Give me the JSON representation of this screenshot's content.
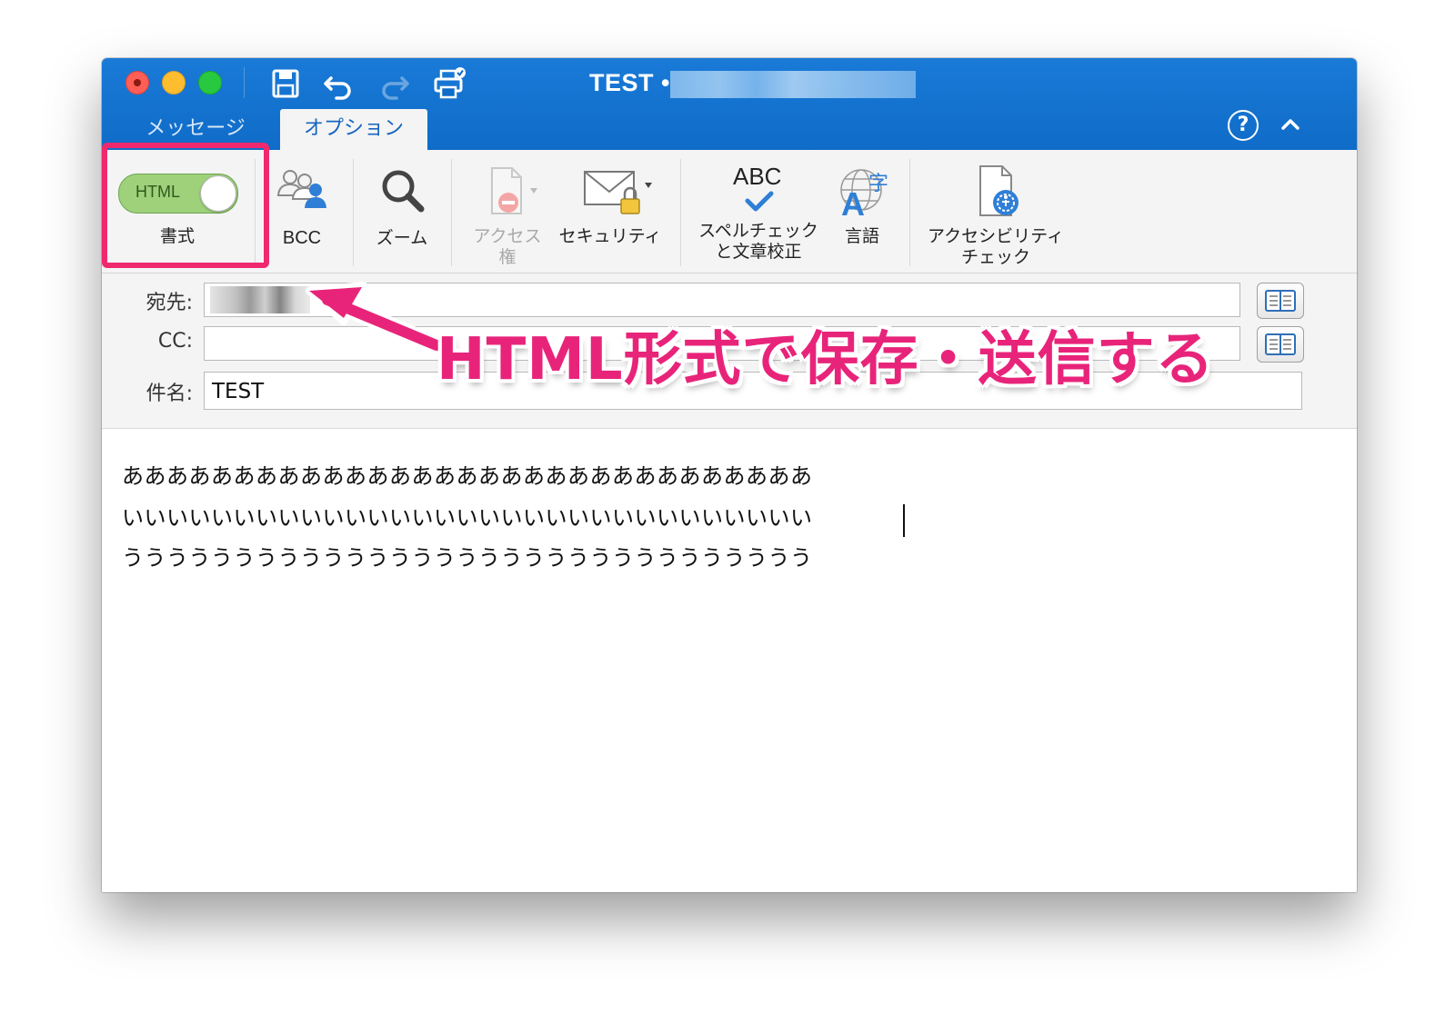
{
  "window": {
    "title": "TEST •",
    "tabs": [
      {
        "label": "メッセージ",
        "active": false
      },
      {
        "label": "オプション",
        "active": true
      }
    ],
    "help_label": "?"
  },
  "ribbon": {
    "format": {
      "toggle_text": "HTML",
      "label": "書式"
    },
    "bcc": {
      "label": "BCC"
    },
    "zoom": {
      "label": "ズーム"
    },
    "access": {
      "label_line1": "アクセス",
      "label_line2": "権",
      "disabled": true
    },
    "security": {
      "label": "セキュリティ"
    },
    "spellcheck": {
      "icon_text": "ABC",
      "label_line1": "スペルチェック",
      "label_line2": "と文章校正"
    },
    "language": {
      "label": "言語"
    },
    "accessibility": {
      "label_line1": "アクセシビリティ",
      "label_line2": "チェック"
    }
  },
  "fields": {
    "to_label": "宛先:",
    "cc_label": "CC:",
    "subject_label": "件名:",
    "subject_value": "TEST",
    "cc_value": ""
  },
  "body": {
    "lines": [
      "あああああああああああああああああああああああああああああああ",
      "いいいいいいいいいいいいいいいいいいいいいいいいいいいいいいい",
      "ううううううううううううううううううううううううううううううう"
    ]
  },
  "annotation": {
    "text": "HTML形式で保存・送信する",
    "color": "#e8247a"
  },
  "colors": {
    "titlebar": "#0f6cc8",
    "highlight": "#f0296f"
  }
}
